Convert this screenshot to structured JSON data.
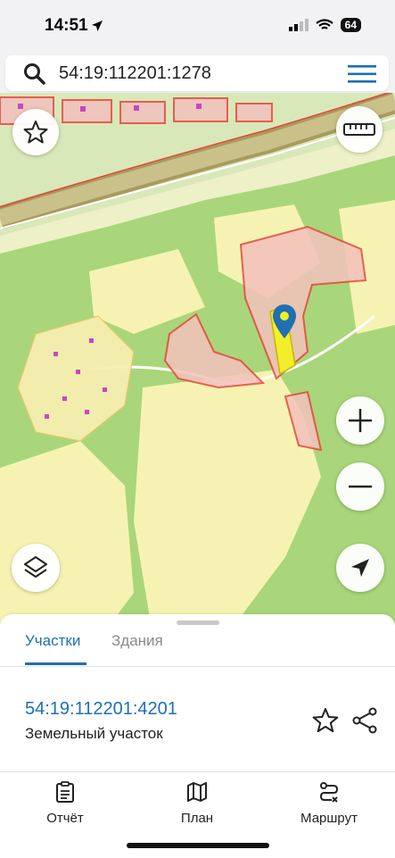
{
  "status": {
    "time": "14:51",
    "battery": "64"
  },
  "search": {
    "value": "54:19:112201:1278"
  },
  "tabs": [
    {
      "label": "Участки",
      "active": true
    },
    {
      "label": "Здания",
      "active": false
    }
  ],
  "parcel": {
    "id": "54:19:112201:4201",
    "type": "Земельный участок"
  },
  "nav": [
    {
      "label": "Отчёт",
      "icon": "report-icon"
    },
    {
      "label": "План",
      "icon": "map-icon"
    },
    {
      "label": "Маршрут",
      "icon": "route-icon"
    }
  ],
  "colors": {
    "accent": "#1e6fb4",
    "parcel_border": "#e8463c",
    "highlight": "#f3ee2a",
    "forest": "#a9d67a",
    "field": "#f6f3b2"
  }
}
